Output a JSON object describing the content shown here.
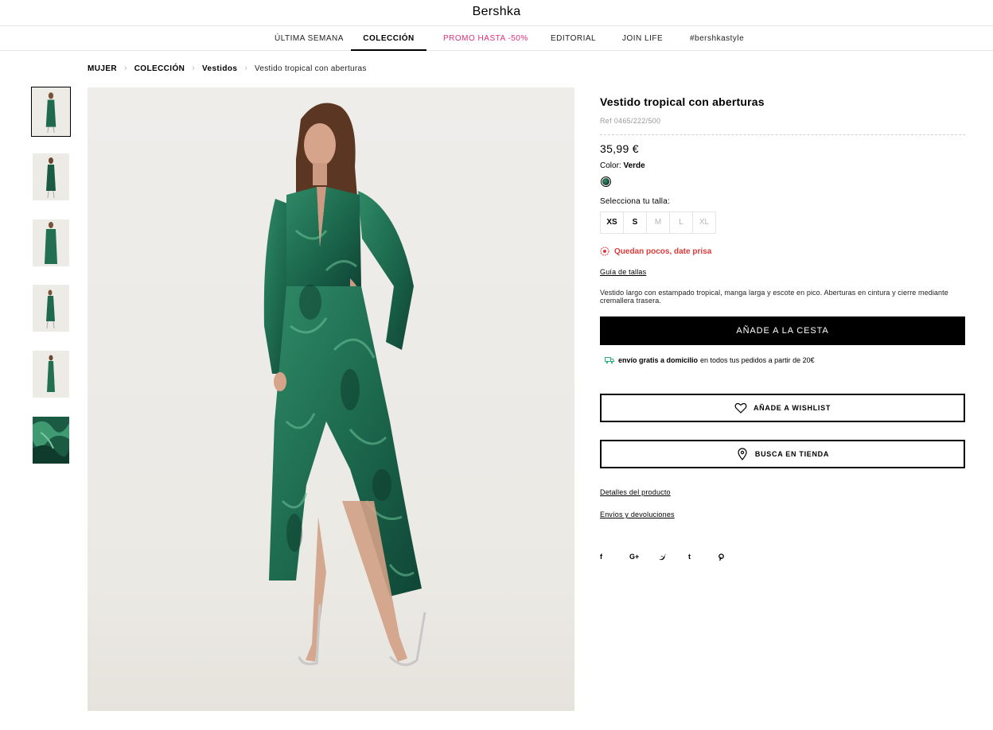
{
  "brand": "Bershka",
  "nav": [
    "ÚLTIMA SEMANA",
    "COLECCIÓN",
    "PROMO HASTA -50%",
    "EDITORIAL",
    "JOIN LIFE",
    "#bershkastyle"
  ],
  "breadcrumb": {
    "items": [
      "MUJER",
      "COLECCIÓN",
      "Vestidos"
    ],
    "current": "Vestido tropical con aberturas"
  },
  "product": {
    "title": "Vestido tropical con aberturas",
    "ref": "Ref 0465/222/500",
    "price": "35,99 €",
    "color_label": "Color:",
    "color_value": "Verde",
    "size_prompt": "Selecciona tu talla:",
    "sizes": [
      {
        "label": "XS",
        "available": true
      },
      {
        "label": "S",
        "available": true
      },
      {
        "label": "M",
        "available": false
      },
      {
        "label": "L",
        "available": false
      },
      {
        "label": "XL",
        "available": false
      }
    ],
    "stock_warning": "Quedan pocos, date prisa",
    "size_guide": "Guía de tallas",
    "description": "Vestido largo con estampado tropical, manga larga y escote en pico. Aberturas en cintura y cierre mediante cremallera trasera.",
    "add_to_cart": "AÑADE A LA CESTA",
    "shipping_bold": "envío gratis a domicilio",
    "shipping_rest": "en todos tus pedidos a partir de 20€",
    "wishlist": "AÑADE A WISHLIST",
    "find_store": "BUSCA EN TIENDA",
    "details_link": "Detalles del producto",
    "returns_link": "Envíos y devoluciones"
  },
  "social": [
    "f",
    "G+",
    "twitter-icon",
    "t",
    "pinterest-icon"
  ],
  "colors": {
    "promo": "#e0307a",
    "stock": "#d93a3a",
    "shipping_icon": "#2fb27a",
    "dress": "#1f6a4e"
  }
}
